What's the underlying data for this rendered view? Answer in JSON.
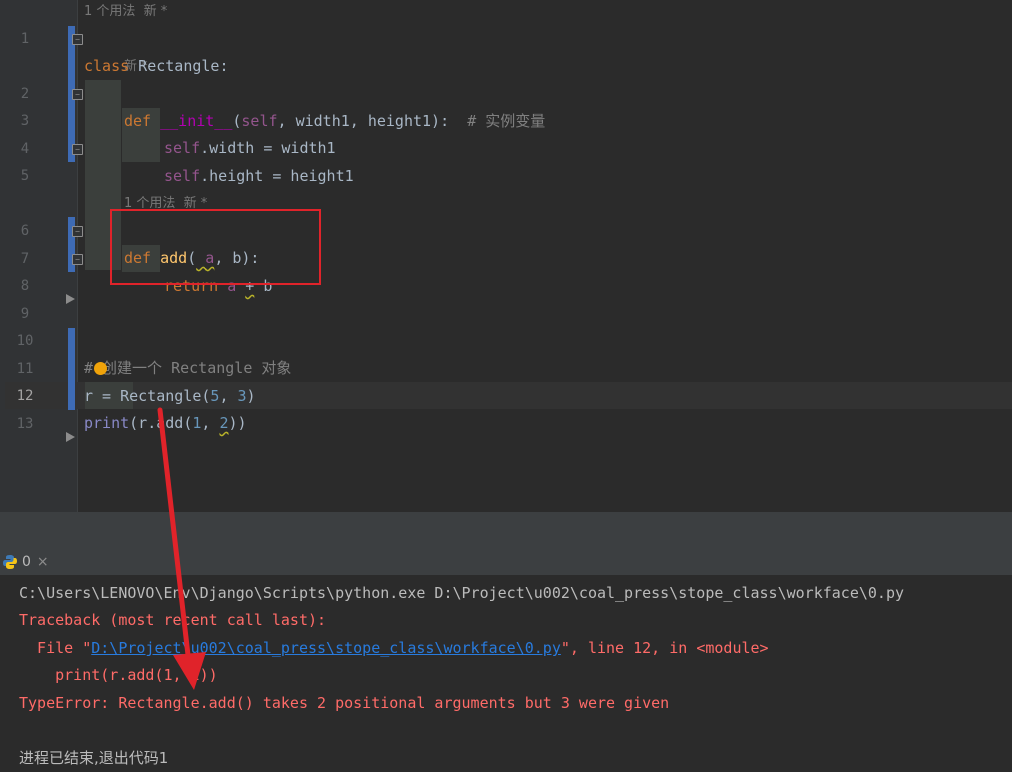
{
  "editor": {
    "hints": {
      "class_usage": "1 个用法  新 *",
      "init_new": "新 *",
      "add_usage": "1 个用法  新 *"
    },
    "line_numbers": [
      "1",
      "2",
      "3",
      "4",
      "5",
      "6",
      "7",
      "8",
      "9",
      "10",
      "11",
      "12",
      "13"
    ],
    "active_line": "12",
    "lines": {
      "l1_kw": "class",
      "l1_name": " Rectangle:",
      "l2_kw": "def",
      "l2_fn": "__init__",
      "l2_open": "(",
      "l2_self": "self",
      "l2_params": ", width1, height1):  ",
      "l2_cmt": "# 实例变量",
      "l3_self": "self",
      "l3_rest": ".width = width1",
      "l4_self": "self",
      "l4_rest": ".height = height1",
      "l6_kw": "def",
      "l6_fn": "add",
      "l6_open": "(",
      "l6_a": " a",
      "l6_rest": ", b):",
      "l7_kw": "return",
      "l7_a": " a ",
      "l7_plus": "+",
      "l7_b": " b",
      "l10_cmt": "# 创建一个 Rectangle 对象",
      "l11_r": "r",
      "l11_rest": "= Rectangle(",
      "l11_n1": "5",
      "l11_sep": ", ",
      "l11_n2": "3",
      "l11_close": ")",
      "l12_print": "print",
      "l12_mid": "(r.add(",
      "l12_n1": "1",
      "l12_sep": ", ",
      "l12_n2": "2",
      "l12_close": "))"
    }
  },
  "run_panel": {
    "tab_label": "0",
    "tab_close": "×"
  },
  "console": {
    "cmd": "C:\\Users\\LENOVO\\Env\\Django\\Scripts\\python.exe D:\\Project\\u002\\coal_press\\stope_class\\workface\\0.py",
    "traceback": "Traceback (most recent call last):",
    "file_prefix": "  File \"",
    "file_link": "D:\\Project\\u002\\coal_press\\stope_class\\workface\\0.py",
    "file_suffix": "\", line 12, in <module>",
    "code_line": "    print(r.add(1, 2))",
    "error": "TypeError: Rectangle.add() takes 2 positional arguments but 3 were given",
    "exit": "进程已结束,退出代码1"
  },
  "colors": {
    "annotation_red": "#e0232a",
    "error_text": "#ff6b68",
    "link": "#287bde"
  }
}
